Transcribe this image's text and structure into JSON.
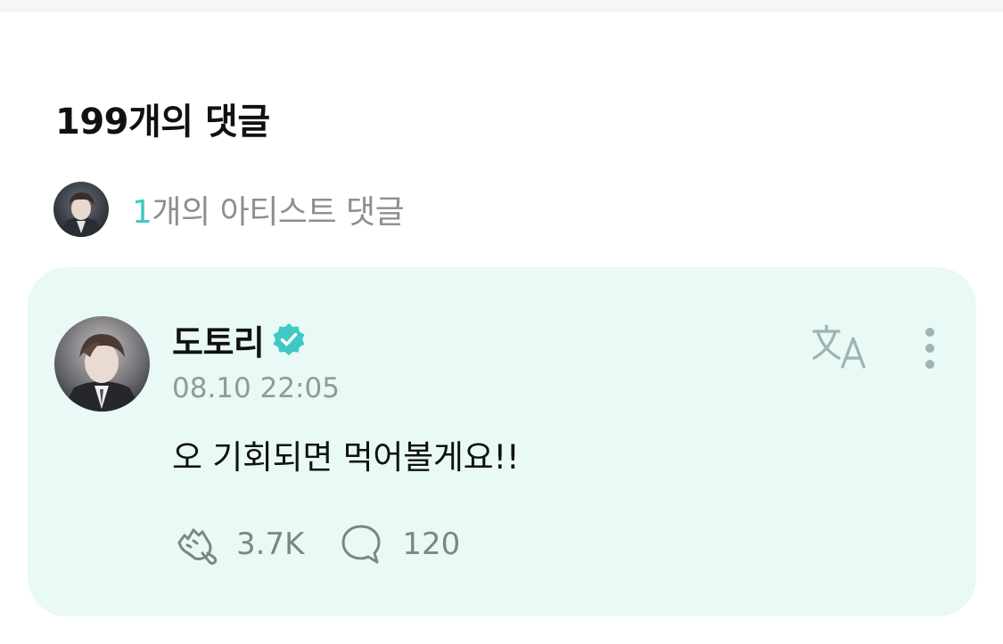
{
  "comments_header": {
    "count_label": "199개의 댓글"
  },
  "artist_comments": {
    "count": "1",
    "label": "개의 아티스트 댓글"
  },
  "comment": {
    "author": "도토리",
    "verified_icon": "verified-badge-icon",
    "timestamp": "08.10 22:05",
    "text": "오 기회되면 먹어볼게요!!",
    "likes": "3.7K",
    "replies": "120",
    "translate_icon": "translate-icon",
    "more_icon": "more-vertical-icon"
  },
  "colors": {
    "accent": "#3fc9c5",
    "card_background": "#e8f9f6",
    "secondary_text": "#8e8e8e"
  }
}
